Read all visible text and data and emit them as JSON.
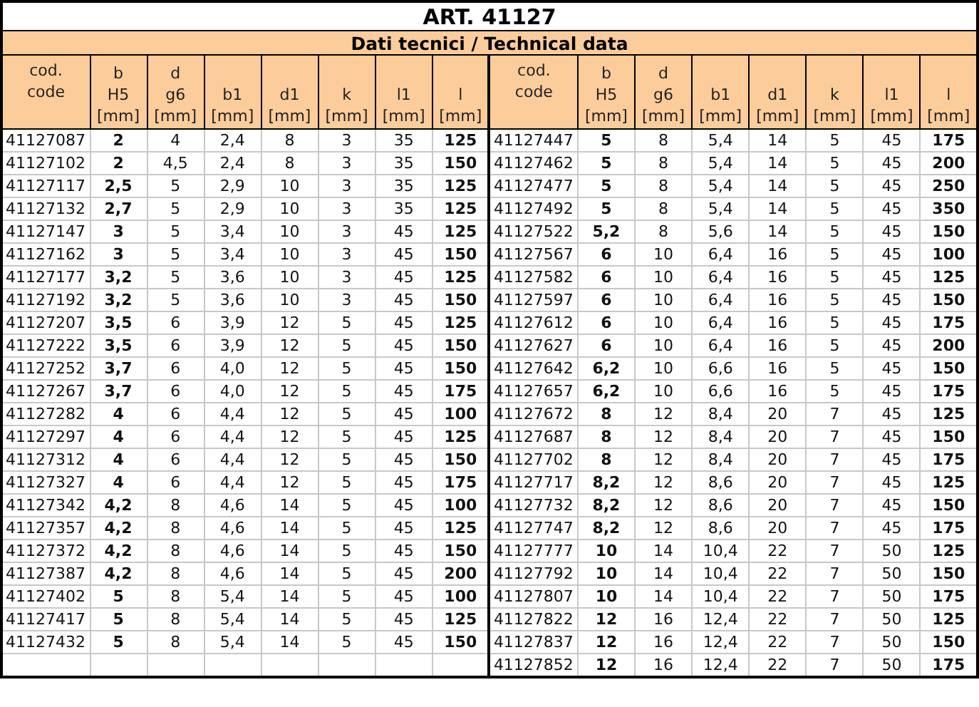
{
  "title": "ART. 41127",
  "subtitle": "Dati tecnici / Technical data",
  "tables": [
    {
      "columns": [
        "cod.\ncode",
        "b\nH5\n[mm]",
        "d\ng6\n[mm]",
        "b1\n[mm]",
        "d1\n[mm]",
        "k\n[mm]",
        "l1\n[mm]",
        "l\n[mm]"
      ],
      "rows": [
        [
          "41127087",
          "2",
          "4",
          "2,4",
          "8",
          "3",
          "35",
          "125"
        ],
        [
          "41127102",
          "2",
          "4,5",
          "2,4",
          "8",
          "3",
          "35",
          "150"
        ],
        [
          "41127117",
          "2,5",
          "5",
          "2,9",
          "10",
          "3",
          "35",
          "125"
        ],
        [
          "41127132",
          "2,7",
          "5",
          "2,9",
          "10",
          "3",
          "35",
          "125"
        ],
        [
          "41127147",
          "3",
          "5",
          "3,4",
          "10",
          "3",
          "45",
          "125"
        ],
        [
          "41127162",
          "3",
          "5",
          "3,4",
          "10",
          "3",
          "45",
          "150"
        ],
        [
          "41127177",
          "3,2",
          "5",
          "3,6",
          "10",
          "3",
          "45",
          "125"
        ],
        [
          "41127192",
          "3,2",
          "5",
          "3,6",
          "10",
          "3",
          "45",
          "150"
        ],
        [
          "41127207",
          "3,5",
          "6",
          "3,9",
          "12",
          "5",
          "45",
          "125"
        ],
        [
          "41127222",
          "3,5",
          "6",
          "3,9",
          "12",
          "5",
          "45",
          "150"
        ],
        [
          "41127252",
          "3,7",
          "6",
          "4,0",
          "12",
          "5",
          "45",
          "150"
        ],
        [
          "41127267",
          "3,7",
          "6",
          "4,0",
          "12",
          "5",
          "45",
          "175"
        ],
        [
          "41127282",
          "4",
          "6",
          "4,4",
          "12",
          "5",
          "45",
          "100"
        ],
        [
          "41127297",
          "4",
          "6",
          "4,4",
          "12",
          "5",
          "45",
          "125"
        ],
        [
          "41127312",
          "4",
          "6",
          "4,4",
          "12",
          "5",
          "45",
          "150"
        ],
        [
          "41127327",
          "4",
          "6",
          "4,4",
          "12",
          "5",
          "45",
          "175"
        ],
        [
          "41127342",
          "4,2",
          "8",
          "4,6",
          "14",
          "5",
          "45",
          "100"
        ],
        [
          "41127357",
          "4,2",
          "8",
          "4,6",
          "14",
          "5",
          "45",
          "125"
        ],
        [
          "41127372",
          "4,2",
          "8",
          "4,6",
          "14",
          "5",
          "45",
          "150"
        ],
        [
          "41127387",
          "4,2",
          "8",
          "4,6",
          "14",
          "5",
          "45",
          "200"
        ],
        [
          "41127402",
          "5",
          "8",
          "5,4",
          "14",
          "5",
          "45",
          "100"
        ],
        [
          "41127417",
          "5",
          "8",
          "5,4",
          "14",
          "5",
          "45",
          "125"
        ],
        [
          "41127432",
          "5",
          "8",
          "5,4",
          "14",
          "5",
          "45",
          "150"
        ]
      ]
    },
    {
      "columns": [
        "cod.\ncode",
        "b\nH5\n[mm]",
        "d\ng6\n[mm]",
        "b1\n[mm]",
        "d1\n[mm]",
        "k\n[mm]",
        "l1\n[mm]",
        "l\n[mm]"
      ],
      "rows": [
        [
          "41127447",
          "5",
          "8",
          "5,4",
          "14",
          "5",
          "45",
          "175"
        ],
        [
          "41127462",
          "5",
          "8",
          "5,4",
          "14",
          "5",
          "45",
          "200"
        ],
        [
          "41127477",
          "5",
          "8",
          "5,4",
          "14",
          "5",
          "45",
          "250"
        ],
        [
          "41127492",
          "5",
          "8",
          "5,4",
          "14",
          "5",
          "45",
          "350"
        ],
        [
          "41127522",
          "5,2",
          "8",
          "5,6",
          "14",
          "5",
          "45",
          "150"
        ],
        [
          "41127567",
          "6",
          "10",
          "6,4",
          "16",
          "5",
          "45",
          "100"
        ],
        [
          "41127582",
          "6",
          "10",
          "6,4",
          "16",
          "5",
          "45",
          "125"
        ],
        [
          "41127597",
          "6",
          "10",
          "6,4",
          "16",
          "5",
          "45",
          "150"
        ],
        [
          "41127612",
          "6",
          "10",
          "6,4",
          "16",
          "5",
          "45",
          "175"
        ],
        [
          "41127627",
          "6",
          "10",
          "6,4",
          "16",
          "5",
          "45",
          "200"
        ],
        [
          "41127642",
          "6,2",
          "10",
          "6,6",
          "16",
          "5",
          "45",
          "150"
        ],
        [
          "41127657",
          "6,2",
          "10",
          "6,6",
          "16",
          "5",
          "45",
          "175"
        ],
        [
          "41127672",
          "8",
          "12",
          "8,4",
          "20",
          "7",
          "45",
          "125"
        ],
        [
          "41127687",
          "8",
          "12",
          "8,4",
          "20",
          "7",
          "45",
          "150"
        ],
        [
          "41127702",
          "8",
          "12",
          "8,4",
          "20",
          "7",
          "45",
          "175"
        ],
        [
          "41127717",
          "8,2",
          "12",
          "8,6",
          "20",
          "7",
          "45",
          "125"
        ],
        [
          "41127732",
          "8,2",
          "12",
          "8,6",
          "20",
          "7",
          "45",
          "150"
        ],
        [
          "41127747",
          "8,2",
          "12",
          "8,6",
          "20",
          "7",
          "45",
          "175"
        ],
        [
          "41127777",
          "10",
          "14",
          "10,4",
          "22",
          "7",
          "50",
          "125"
        ],
        [
          "41127792",
          "10",
          "14",
          "10,4",
          "22",
          "7",
          "50",
          "150"
        ],
        [
          "41127807",
          "10",
          "14",
          "10,4",
          "22",
          "7",
          "50",
          "175"
        ],
        [
          "41127822",
          "12",
          "16",
          "12,4",
          "22",
          "7",
          "50",
          "125"
        ],
        [
          "41127837",
          "12",
          "16",
          "12,4",
          "22",
          "7",
          "50",
          "150"
        ],
        [
          "41127852",
          "12",
          "16",
          "12,4",
          "22",
          "7",
          "50",
          "175"
        ]
      ]
    }
  ]
}
